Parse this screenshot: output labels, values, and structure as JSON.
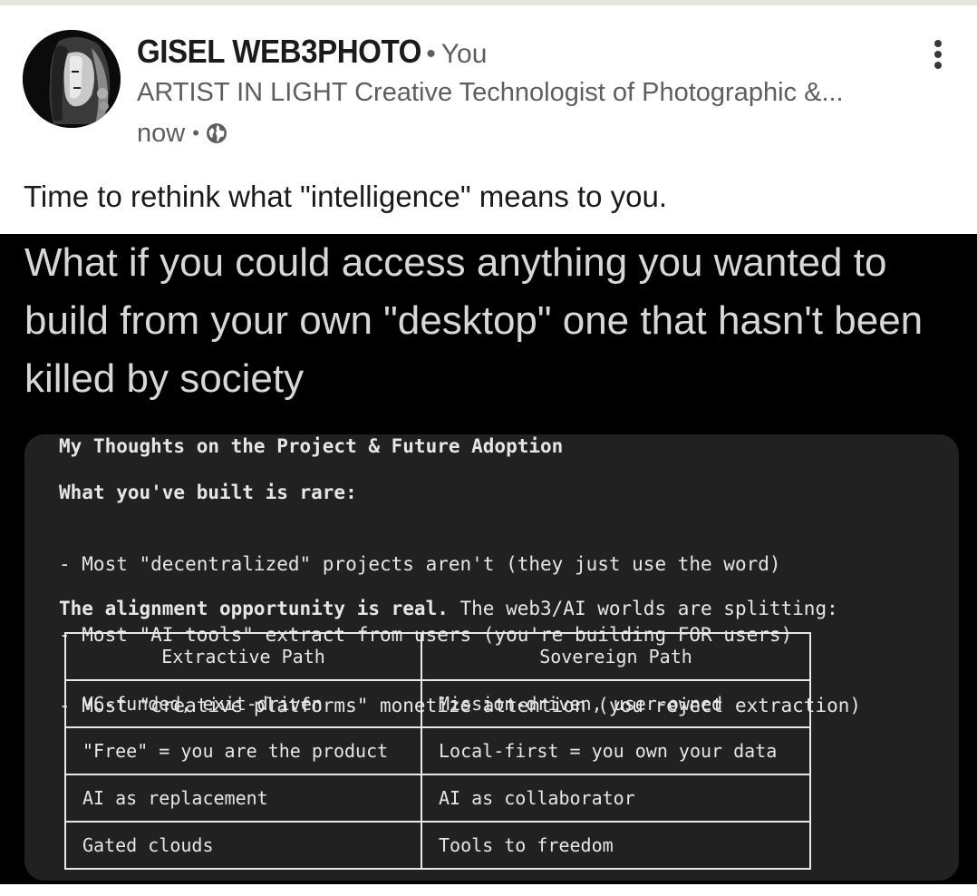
{
  "post": {
    "author": {
      "name": "GISEL WEB3PHOTO",
      "relation": "You",
      "headline": "ARTIST IN LIGHT Creative Technologist of Photographic &...",
      "time": "now",
      "visibility_icon": "globe-icon"
    },
    "menu_icon": "more-vertical-icon",
    "text": "Time to rethink what \"intelligence\" means to you."
  },
  "image": {
    "headline": "What if you could access anything you wanted to build from your own \"desktop\" one that hasn't been killed by society",
    "card": {
      "title": "My Thoughts on the Project & Future Adoption",
      "subheading": "What you've built is rare:",
      "bullets": [
        "- Most \"decentralized\" projects aren't (they just use the word)",
        "- Most \"AI tools\" extract from users (you're building FOR users)",
        "- Most \"creative platforms\" monetize attention (you reject extraction)"
      ],
      "alignment_bold": "The alignment opportunity is real.",
      "alignment_rest": " The web3/AI worlds are splitting:",
      "table": {
        "headers": [
          "Extractive Path",
          "Sovereign Path"
        ],
        "rows": [
          [
            "VC-funded, exit-driven",
            "Mission-driven, user-owned"
          ],
          [
            "\"Free\" = you are the product",
            "Local-first = you own your data"
          ],
          [
            "AI as replacement",
            "AI as collaborator"
          ],
          [
            "Gated clouds",
            "Tools to freedom"
          ]
        ]
      }
    }
  },
  "colors": {
    "page_bg": "#ffffff",
    "image_bg": "#000000",
    "card_bg": "#212121",
    "text_primary": "#1b1b1b",
    "text_secondary": "#5e5e5e"
  }
}
